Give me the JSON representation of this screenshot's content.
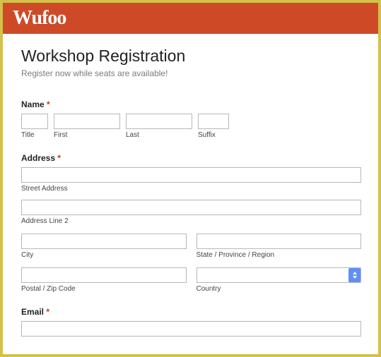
{
  "brand": {
    "logo_text": "Wufoo"
  },
  "form": {
    "title": "Workshop Registration",
    "description": "Register now while seats are available!"
  },
  "fields": {
    "name": {
      "label": "Name",
      "required_mark": "*",
      "parts": {
        "title": {
          "sublabel": "Title",
          "value": ""
        },
        "first": {
          "sublabel": "First",
          "value": ""
        },
        "last": {
          "sublabel": "Last",
          "value": ""
        },
        "suffix": {
          "sublabel": "Suffix",
          "value": ""
        }
      }
    },
    "address": {
      "label": "Address",
      "required_mark": "*",
      "street": {
        "sublabel": "Street Address",
        "value": ""
      },
      "line2": {
        "sublabel": "Address Line 2",
        "value": ""
      },
      "city": {
        "sublabel": "City",
        "value": ""
      },
      "state": {
        "sublabel": "State / Province / Region",
        "value": ""
      },
      "postal": {
        "sublabel": "Postal / Zip Code",
        "value": ""
      },
      "country": {
        "sublabel": "Country",
        "selected": ""
      }
    },
    "email": {
      "label": "Email",
      "required_mark": "*",
      "value": ""
    }
  }
}
